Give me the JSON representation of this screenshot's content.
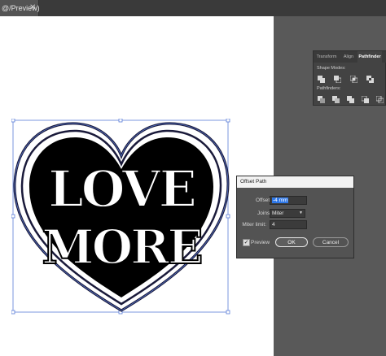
{
  "document_tab": {
    "title": "@/Preview)",
    "close": "✕"
  },
  "panel": {
    "tabs": [
      "Transform",
      "Align",
      "Pathfinder"
    ],
    "active_tab": "Pathfinder",
    "shape_modes_label": "Shape Modes:",
    "pathfinders_label": "Pathfinders:",
    "shape_mode_icons": [
      "unite-icon",
      "minus-front-icon",
      "intersect-icon",
      "exclude-icon",
      "expand-button"
    ],
    "pathfinder_icons": [
      "divide-icon",
      "trim-icon",
      "merge-icon",
      "crop-icon",
      "outline-icon"
    ]
  },
  "dialog": {
    "title": "Offset Path",
    "offset_label": "Offset:",
    "offset_value": "-4 mm",
    "joins_label": "Joins:",
    "joins_value": "Miter",
    "miter_label": "Miter limit:",
    "miter_value": "4",
    "preview_label": "Preview",
    "preview_checked": true,
    "ok_label": "OK",
    "cancel_label": "Cancel"
  },
  "artwork": {
    "line1": "LOVE",
    "line2": "MORE"
  },
  "colors": {
    "accent": "#2f78e8",
    "selection": "#5b7dd8",
    "outline": "#1a1a3a"
  }
}
